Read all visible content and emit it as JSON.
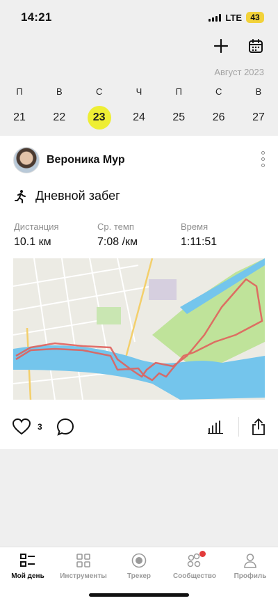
{
  "status": {
    "time": "14:21",
    "network": "LTE",
    "battery": "43"
  },
  "header": {
    "add_icon": "plus-icon",
    "calendar_icon": "calendar-icon",
    "month": "Август 2023"
  },
  "week": {
    "days": [
      "П",
      "В",
      "С",
      "Ч",
      "П",
      "С",
      "В"
    ],
    "dates": [
      "21",
      "22",
      "23",
      "24",
      "25",
      "26",
      "27"
    ],
    "selected": "23",
    "accent": "#eeee34"
  },
  "post": {
    "user": "Вероника Мур",
    "activity": "Дневной забег",
    "activity_icon": "running-icon",
    "stats": [
      {
        "label": "Дистанция",
        "value": "10.1 км"
      },
      {
        "label": "Ср. темп",
        "value": "7:08 /км"
      },
      {
        "label": "Время",
        "value": "1:11:51"
      }
    ],
    "route_color": "#e0605c",
    "likes": "3"
  },
  "nav": [
    {
      "label": "Мой день",
      "icon": "my-day-icon",
      "active": true
    },
    {
      "label": "Инструменты",
      "icon": "tools-grid-icon",
      "active": false
    },
    {
      "label": "Трекер",
      "icon": "tracker-icon",
      "active": false
    },
    {
      "label": "Сообщество",
      "icon": "community-icon",
      "active": false,
      "badge": true
    },
    {
      "label": "Профиль",
      "icon": "profile-icon",
      "active": false
    }
  ]
}
